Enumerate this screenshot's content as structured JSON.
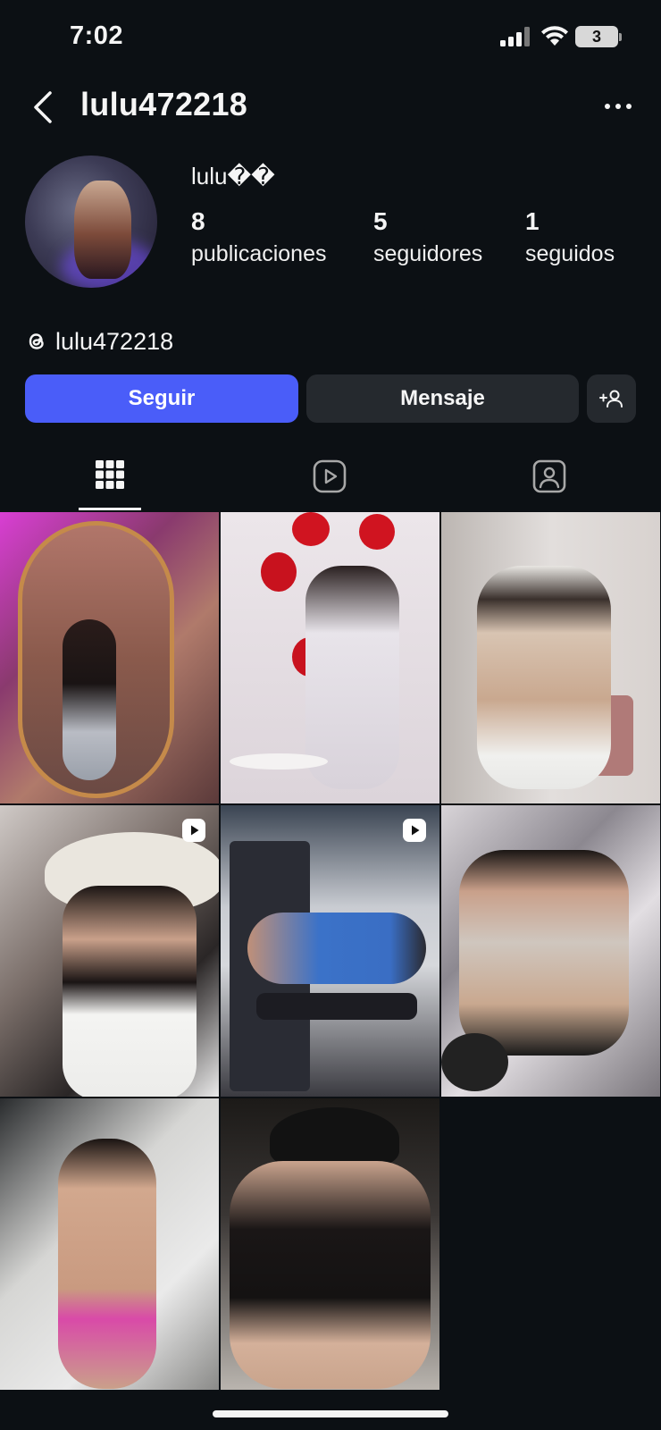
{
  "status_bar": {
    "time": "7:02",
    "battery": "3",
    "icons": [
      "cellular-signal-icon",
      "wifi-icon",
      "battery-icon"
    ]
  },
  "header": {
    "username": "lulu472218",
    "back_icon": "chevron-left-icon",
    "more_icon": "more-horizontal-icon"
  },
  "profile": {
    "display_name": "lulu��",
    "stats": {
      "posts": {
        "count": "8",
        "label": "publicaciones"
      },
      "followers": {
        "count": "5",
        "label": "seguidores"
      },
      "following": {
        "count": "1",
        "label": "seguidos"
      }
    },
    "threads_handle": "lulu472218"
  },
  "actions": {
    "follow_label": "Seguir",
    "message_label": "Mensaje",
    "suggest_icon": "add-person-icon"
  },
  "tabs": [
    {
      "name": "posts",
      "icon": "grid-icon",
      "selected": true
    },
    {
      "name": "reels",
      "icon": "reels-icon",
      "selected": false
    },
    {
      "name": "tagged",
      "icon": "tagged-person-icon",
      "selected": false
    }
  ],
  "posts": [
    {
      "is_reel": false
    },
    {
      "is_reel": false
    },
    {
      "is_reel": false
    },
    {
      "is_reel": true
    },
    {
      "is_reel": true
    },
    {
      "is_reel": false
    },
    {
      "is_reel": false
    },
    {
      "is_reel": false
    }
  ],
  "colors": {
    "background": "#0c1014",
    "follow_button": "#4a5df9",
    "secondary_button": "#25292e",
    "text": "#f5f5f5"
  }
}
